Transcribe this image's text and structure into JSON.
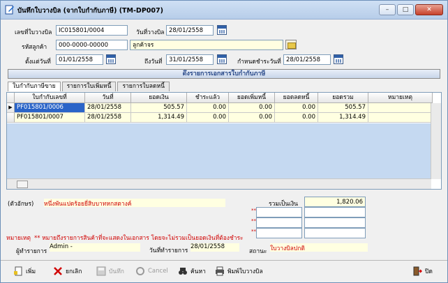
{
  "window": {
    "title": "บันทึกใบวางบิล (จากใบกำกับภาษี) (TM-DP007)",
    "controls": {
      "minimize": "–",
      "maximize": "□",
      "close": "✕"
    }
  },
  "header": {
    "bill_no_label": "เลขที่ใบวางบิล",
    "bill_no_value": "IC015801/0004",
    "bill_date_label": "วันที่วางบิล",
    "bill_date_value": "28/01/2558",
    "customer_label": "รหัสลูกค้า",
    "customer_code": "000-0000-00000",
    "customer_name": "ลูกค้าจร",
    "from_date_label": "ตั้งแต่วันที่",
    "from_date_value": "01/01/2558",
    "to_date_label": "ถึงวันที่",
    "to_date_value": "31/01/2558",
    "due_date_label": "กำหนดชำระวันที่",
    "due_date_value": "28/01/2558"
  },
  "banner": {
    "label": "ดึงรายการเอกสารใบกำกับภาษี"
  },
  "tabs": [
    {
      "label": "ใบกำกับภาษีขาย",
      "active": true
    },
    {
      "label": "รายการใบเพิ่มหนี้",
      "active": false
    },
    {
      "label": "รายการใบลดหนี้",
      "active": false
    }
  ],
  "grid": {
    "columns": [
      "ใบกำกับเลขที่",
      "วันที่",
      "ยอดเงิน",
      "ชำระแล้ว",
      "ยอดเพิ่มหนี้",
      "ยอดลดหนี้",
      "ยอดรวม",
      "หมายเหตุ"
    ],
    "rows": [
      {
        "invoice_no": "PF015801/0006",
        "date": "28/01/2558",
        "amount": "505.57",
        "paid": "0.00",
        "debit": "0.00",
        "credit": "0.00",
        "total": "505.57",
        "note": ""
      },
      {
        "invoice_no": "PF015801/0007",
        "date": "28/01/2558",
        "amount": "1,314.49",
        "paid": "0.00",
        "debit": "0.00",
        "credit": "0.00",
        "total": "1,314.49",
        "note": ""
      }
    ]
  },
  "summary": {
    "text_amount_label": "(ตัวอักษร)",
    "text_amount_value": "หนึ่งพันแปดร้อยยี่สิบบาทหกสตางค์",
    "total_label": "รวมเป็นเงิน",
    "total_value": "1,820.06",
    "blank_marks": [
      "**",
      "**",
      "**"
    ]
  },
  "remark": {
    "label": "หมายเหตุ",
    "text": "** หมายถึงรายการสินค้าที่จะแสดงในเอกสาร โดยจะไม่รวมเป็นยอดเงินที่ต้องชำระ"
  },
  "footer_info": {
    "operator_label": "ผู้ทำรายการ",
    "operator_value": "Admin -",
    "txn_date_label": "วันที่ทำรายการ",
    "txn_date_value": "28/01/2558",
    "status_label": "สถานะ",
    "status_value": "ใบวางบิลปกติ"
  },
  "toolbar": {
    "add": "เพิ่ม",
    "cancel_doc": "ยกเลิก",
    "save": "บันทึก",
    "cancel": "Cancel",
    "search": "ค้นหา",
    "print": "พิมพ์ใบวางบิล",
    "exit": "ปิด"
  },
  "colors": {
    "accent": "#2a64c8",
    "highlight": "#ffffe1",
    "grid_empty": "#c5d9f1",
    "alert": "#d00000"
  }
}
